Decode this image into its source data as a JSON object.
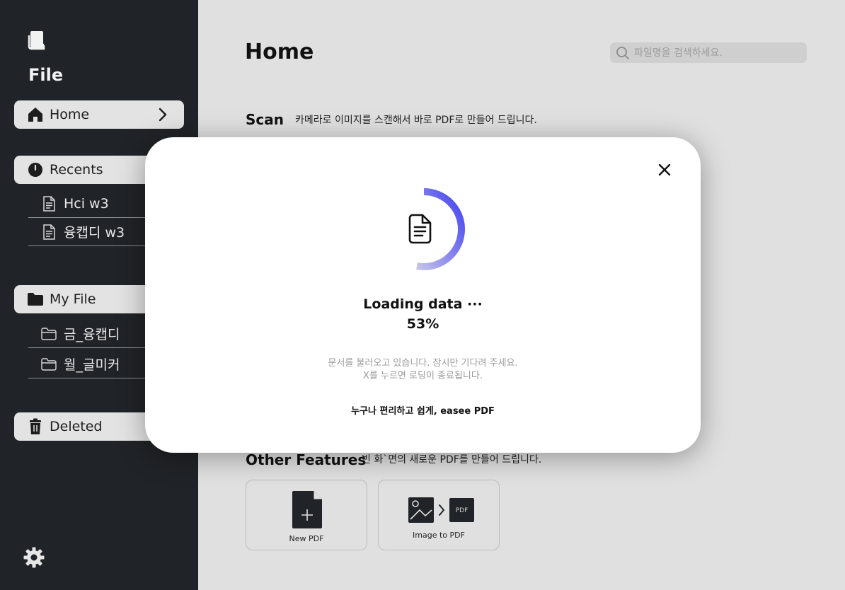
{
  "sidebar": {
    "app_title": "File",
    "home": {
      "label": "Home",
      "icon": "home-icon"
    },
    "recents": {
      "label": "Recents",
      "icon": "clock-icon",
      "items": [
        {
          "label": "Hci w3",
          "icon": "document-icon"
        },
        {
          "label": "융캡디 w3",
          "icon": "document-icon"
        }
      ]
    },
    "my_file": {
      "label": "My File",
      "icon": "folder-icon",
      "items": [
        {
          "label": "금_융캡디",
          "icon": "folder-outline-icon"
        },
        {
          "label": "월_글미커",
          "icon": "folder-outline-icon"
        }
      ]
    },
    "deleted": {
      "label": "Deleted",
      "icon": "trash-icon"
    },
    "settings_icon": "gear-icon"
  },
  "main": {
    "title": "Home",
    "search": {
      "placeholder": "파일명을 검색하세요."
    },
    "scan": {
      "title": "Scan",
      "description": "카메라로 이미지를 스캔해서 바로 PDF로 만들어 드립니다."
    },
    "other_features": {
      "title": "Other Features",
      "description": "빈 화`면의 새로운 PDF를 만들어 드립니다.",
      "cards": [
        {
          "label": "New PDF",
          "icon": "new-pdf-icon"
        },
        {
          "label": "Image to PDF",
          "icon": "image-to-pdf-icon",
          "badge": "PDF"
        }
      ]
    }
  },
  "modal": {
    "title": "Loading data ···",
    "progress_percent": 53,
    "progress_text": "53%",
    "hint_line1": "문서를 불러오고 있습니다. 잠시만 기다려 주세요.",
    "hint_line2": "X를 누르면 로딩이 종료됩니다.",
    "tagline": "누구나 편리하고 쉽게, easee PDF",
    "accent_color": "#3f3ff0"
  },
  "colors": {
    "sidebar_bg": "#202327",
    "main_bg": "#e0e0e0",
    "modal_bg": "#ffffff",
    "spinner_blue": "#3f3ff0"
  }
}
